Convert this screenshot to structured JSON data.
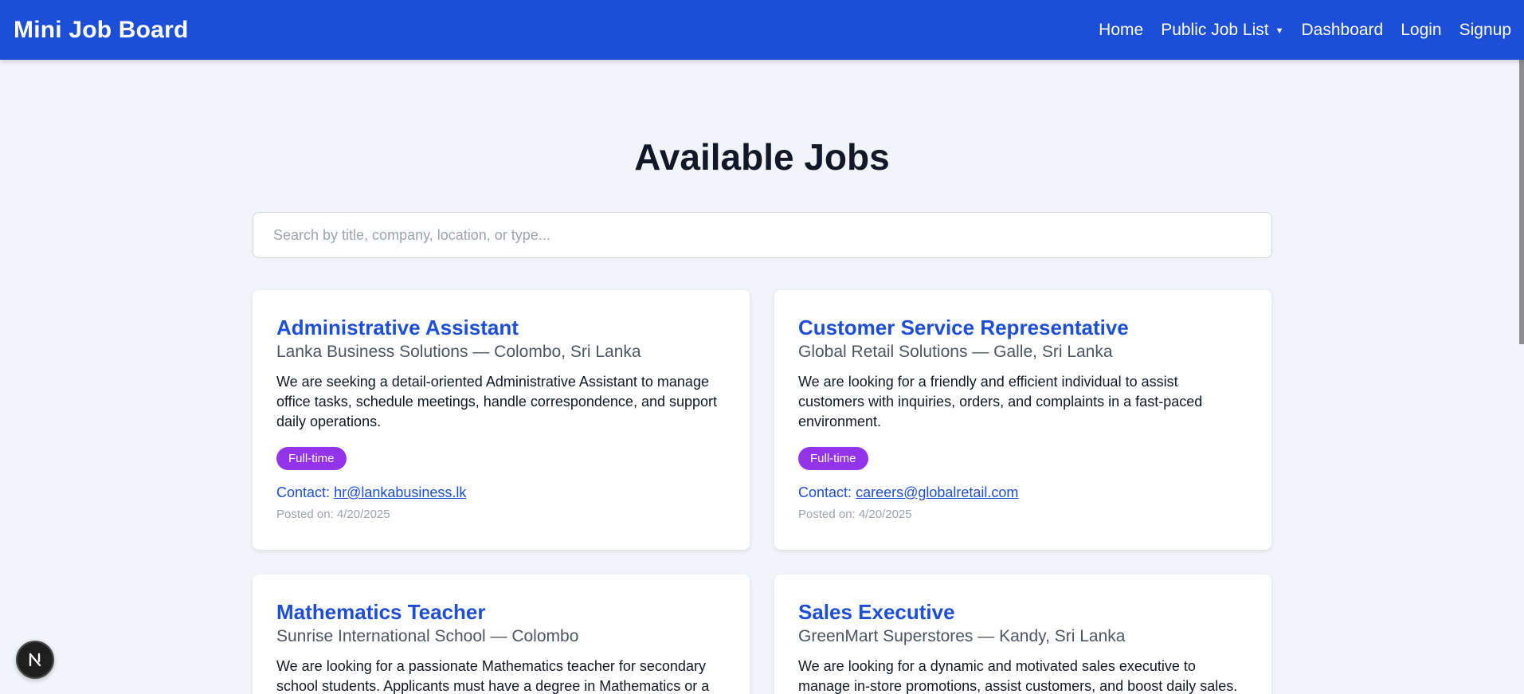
{
  "nav": {
    "brand": "Mini Job Board",
    "links": [
      {
        "label": "Home"
      },
      {
        "label": "Public Job List"
      },
      {
        "label": "Dashboard"
      },
      {
        "label": "Login"
      },
      {
        "label": "Signup"
      }
    ]
  },
  "main": {
    "title": "Available Jobs",
    "search_placeholder": "Search by title, company, location, or type..."
  },
  "jobs": [
    {
      "title": "Administrative Assistant",
      "company_location": "Lanka Business Solutions — Colombo, Sri Lanka",
      "description": "We are seeking a detail-oriented Administrative Assistant to manage office tasks, schedule meetings, handle correspondence, and support daily operations.",
      "type": "Full-time",
      "contact_label": "Contact:",
      "contact_email": "hr@lankabusiness.lk",
      "posted": "Posted on: 4/20/2025"
    },
    {
      "title": "Customer Service Representative",
      "company_location": "Global Retail Solutions — Galle, Sri Lanka",
      "description": "We are looking for a friendly and efficient individual to assist customers with inquiries, orders, and complaints in a fast-paced environment.",
      "type": "Full-time",
      "contact_label": "Contact:",
      "contact_email": "careers@globalretail.com",
      "posted": "Posted on: 4/20/2025"
    },
    {
      "title": "Mathematics Teacher",
      "company_location": "Sunrise International School — Colombo",
      "description": "We are looking for a passionate Mathematics teacher for secondary school students. Applicants must have a degree in Mathematics or a"
    },
    {
      "title": "Sales Executive",
      "company_location": "GreenMart Superstores — Kandy, Sri Lanka",
      "description": "We are looking for a dynamic and motivated sales executive to manage in-store promotions, assist customers, and boost daily sales."
    }
  ],
  "colors": {
    "nav_bg": "#1d4ed8",
    "accent": "#1d4ed8",
    "badge": "#9333ea",
    "page_bg": "#f1f5f9"
  },
  "icons": {
    "dropdown": "caret-down-icon",
    "dev_badge": "nextjs-logo-icon"
  }
}
